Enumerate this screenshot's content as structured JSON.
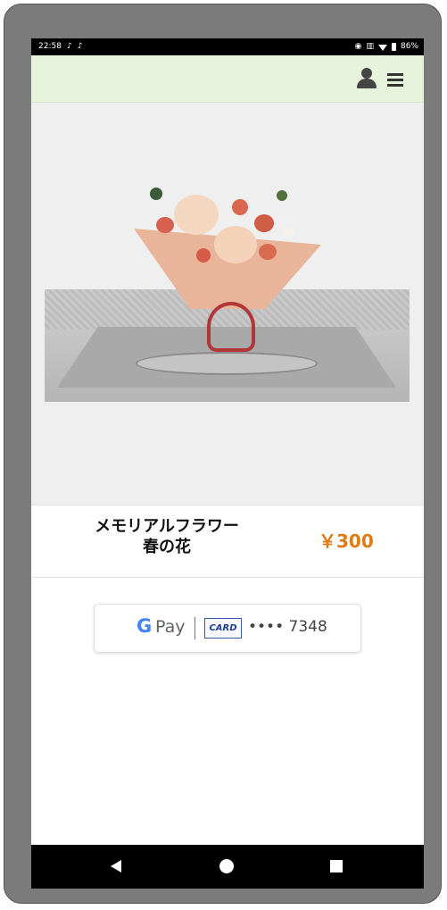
{
  "status_bar": {
    "time": "22:58",
    "battery": "86%",
    "icons": [
      "tiktok-icon",
      "tiktok-icon",
      "vibrate-icon",
      "signal-icon",
      "wifi-icon",
      "battery-icon"
    ]
  },
  "header": {
    "icons": [
      "user-icon",
      "menu-icon"
    ],
    "background": "#e8f3dc"
  },
  "product": {
    "name_line1": "メモリアルフラワー",
    "name_line2": "春の花",
    "price": "￥300",
    "price_color": "#e07b14",
    "image": "bouquet-on-grave-image"
  },
  "payment": {
    "google_g": "G",
    "pay_label": "Pay",
    "card_brand": "CARD",
    "card_number": "•••• 7348"
  },
  "nav_bar": {
    "icons": [
      "back-icon",
      "home-icon",
      "recents-icon"
    ]
  }
}
